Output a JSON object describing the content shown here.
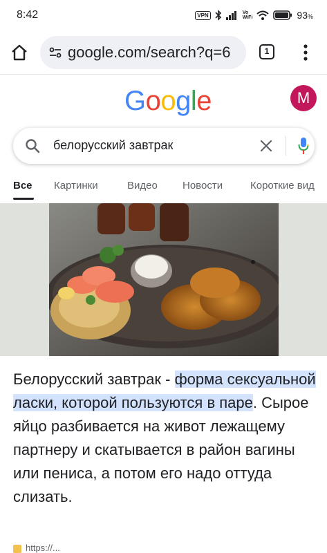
{
  "status_bar": {
    "time": "8:42",
    "vpn": "VPN",
    "vowifi_top": "Vo",
    "vowifi_bottom": "WiFi",
    "battery_pct": "93",
    "battery_unit": "%"
  },
  "browser": {
    "url": "google.com/search?q=6",
    "tab_count": "1",
    "icons": {
      "home": "home-icon",
      "tune": "tune-icon",
      "menu": "more-vert-icon"
    }
  },
  "google": {
    "logo_letters": [
      {
        "ch": "G",
        "color": "#4285F4"
      },
      {
        "ch": "o",
        "color": "#EA4335"
      },
      {
        "ch": "o",
        "color": "#FBBC05"
      },
      {
        "ch": "g",
        "color": "#4285F4"
      },
      {
        "ch": "l",
        "color": "#34A853"
      },
      {
        "ch": "e",
        "color": "#EA4335"
      }
    ],
    "avatar_letter": "M",
    "avatar_color": "#C2185B"
  },
  "search": {
    "query": "белорусский завтрак"
  },
  "tabs": [
    {
      "label": "Все",
      "active": true
    },
    {
      "label": "Картинки",
      "active": false
    },
    {
      "label": "Видео",
      "active": false
    },
    {
      "label": "Новости",
      "active": false
    },
    {
      "label": "Короткие вид",
      "active": false
    }
  ],
  "result": {
    "image_alt_icon": "food-photo",
    "text_before": "Белорусский завтрак - ",
    "text_highlight": "форма сексуальной ласки, которой пользуются в паре",
    "text_after": ". Сырое яйцо разбивается на живот лежащему партнеру и скатывается в район вагины или пениса, а потом его надо оттуда слизать.",
    "source_partial": "https://...",
    "highlight_color": "#D3E3FD"
  }
}
